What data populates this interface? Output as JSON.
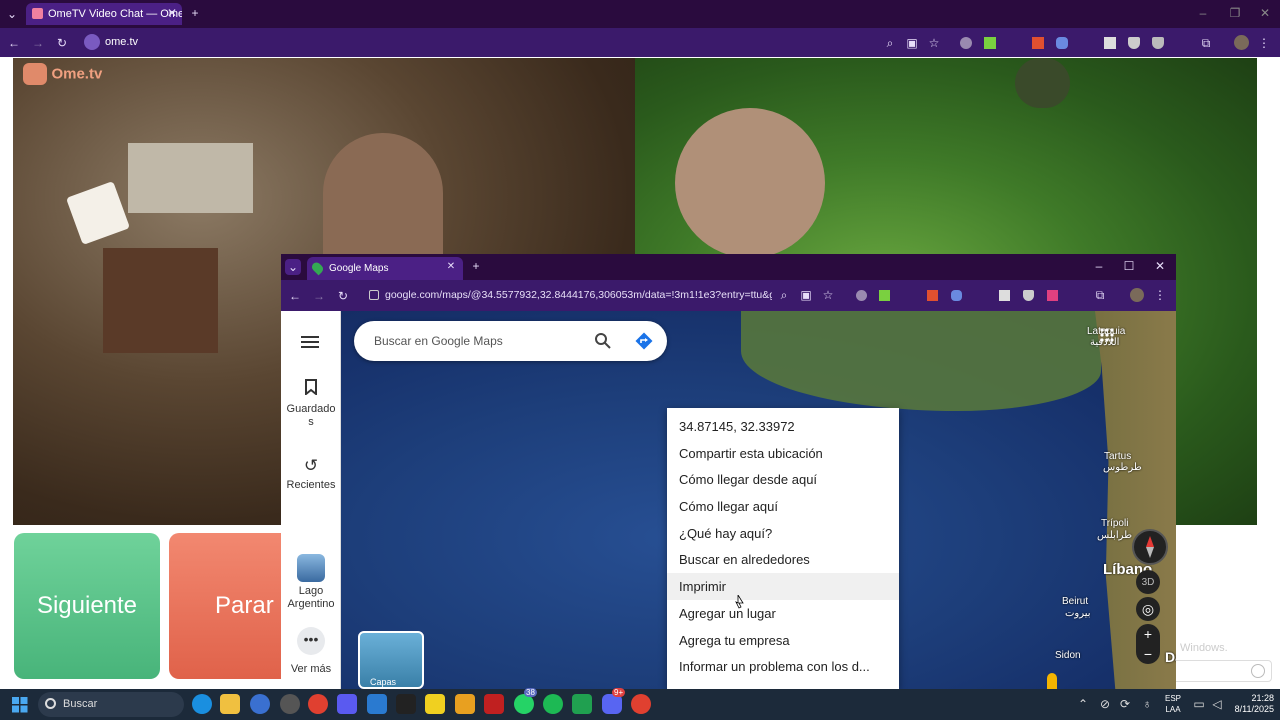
{
  "outer_browser": {
    "tab_title": "OmeTV Video Chat — Ome",
    "url": "ome.tv"
  },
  "ometv": {
    "logo": "Ome.tv",
    "next_label": "Siguiente",
    "stop_label": "Parar"
  },
  "inner_browser": {
    "tab_title": "Google Maps",
    "url": "google.com/maps/@34.5577932,32.8444176,306053m/data=!3m1!1e3?entry=ttu&g_ep=Eg..."
  },
  "maps": {
    "search_placeholder": "Buscar en Google Maps",
    "sidebar": {
      "saved": "Guardados",
      "recent": "Recientes",
      "lake": "Lago Argentino",
      "more": "Ver más"
    },
    "layers_label": "Capas",
    "labels": {
      "latakia": "Lataquia",
      "latakia_ar": "اللاذقية",
      "tartus": "Tartus",
      "tartus_ar": "طرطوس",
      "tripoli": "Trípoli",
      "tripoli_ar": "طرابلس",
      "lebanon": "Líbano",
      "beirut": "Beirut",
      "beirut_ar": "بيروت",
      "sidon": "Sidon",
      "damascus": "Dar"
    },
    "context_menu": [
      "34.87145, 32.33972",
      "Compartir esta ubicación",
      "Cómo llegar desde aquí",
      "Cómo llegar aquí",
      "¿Qué hay aquí?",
      "Buscar en alrededores",
      "Imprimir",
      "Agregar un lugar",
      "Agrega tu empresa",
      "Informar un problema con los d..."
    ],
    "btn_3d": "3D"
  },
  "taskbar": {
    "search": "Buscar",
    "lang": "ESP",
    "lang2": "LAA",
    "time": "21:28",
    "date": "8/11/2025",
    "badge1": "38",
    "badge2": "9+"
  },
  "watermark": "Windows.",
  "colors": {
    "title_bar": "#2a0b3e",
    "accent": "#4b2085",
    "next": "#48b47a",
    "stop": "#e0624a"
  }
}
